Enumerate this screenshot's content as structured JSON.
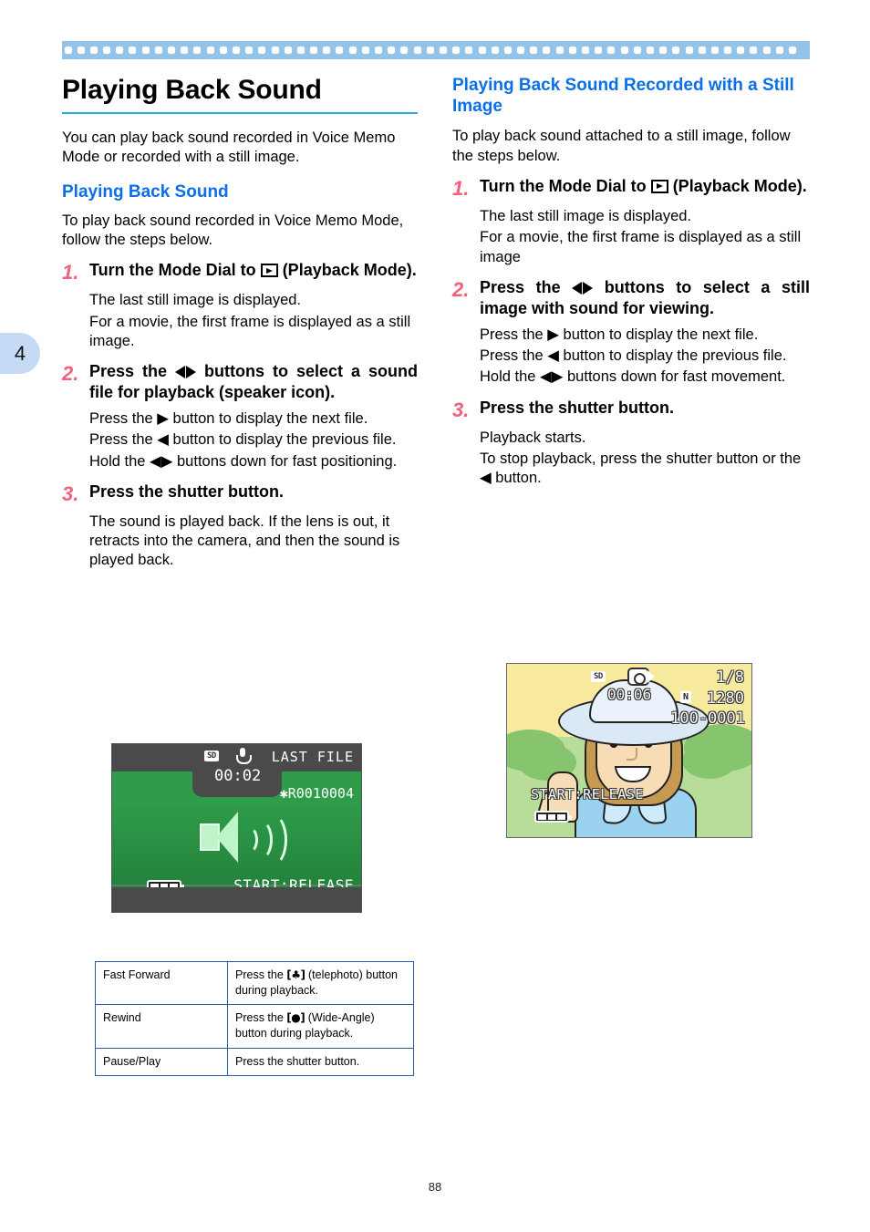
{
  "chapter": {
    "number": "4"
  },
  "page": {
    "number": "88"
  },
  "left": {
    "title": "Playing Back Sound",
    "intro": "You can play back sound recorded in Voice Memo Mode or recorded with a still image.",
    "subheading": "Playing Back Sound",
    "lead": "To play back sound recorded in Voice Memo Mode, follow the steps below.",
    "steps": [
      {
        "num": "1.",
        "head_before": "Turn the Mode Dial to",
        "head_after": "(Playback Mode).",
        "body": [
          "The last still image is displayed.",
          "For a movie, the first frame is displayed as a still image."
        ]
      },
      {
        "num": "2.",
        "head_before": "Press the",
        "head_after": "buttons to select a sound file for playback (speaker icon).",
        "body": [
          "Press the ▶ button to display the next file.",
          "Press the ◀ button to display the previous file.",
          "Hold the ◀▶ buttons down for fast positioning."
        ]
      },
      {
        "num": "3.",
        "head_before": "Press the shutter button.",
        "head_after": "",
        "body": [
          "The sound is played back. If the lens is out, it retracts into the camera, and then the sound is played back."
        ]
      }
    ],
    "lcd": {
      "sd_label": "SD",
      "timer": "00:02",
      "last_file": "LAST FILE",
      "filename": "✱R0010004",
      "start": "START:RELEASE"
    },
    "table": {
      "rows": [
        {
          "action": "Fast Forward",
          "desc_before": "Press the",
          "icon": "telephoto-icon",
          "desc_after": "(telephoto) button during playback."
        },
        {
          "action": "Rewind",
          "desc_before": "Press the",
          "icon": "wide-angle-icon",
          "desc_after": "(Wide-Angle) button during playback."
        },
        {
          "action": "Pause/Play",
          "desc_before": "Press the shutter button.",
          "icon": "",
          "desc_after": ""
        }
      ]
    }
  },
  "right": {
    "subheading": "Playing Back Sound Recorded with a Still Image",
    "lead": "To play back sound attached to a still image, follow the steps below.",
    "steps": [
      {
        "num": "1.",
        "head_before": "Turn the Mode Dial to",
        "head_after": "(Playback Mode).",
        "body": [
          "The last still image is displayed.",
          "For a movie, the first frame is displayed as a still image"
        ]
      },
      {
        "num": "2.",
        "head_before": "Press the",
        "head_after": "buttons to select a still image with sound for viewing.",
        "body": [
          "Press the ▶ button to display the next file.",
          "Press the ◀ button to display the previous file.",
          "Hold the ◀▶ buttons down for fast movement."
        ]
      },
      {
        "num": "3.",
        "head_before": "Press the shutter button.",
        "head_after": "",
        "body": [
          "Playback starts.",
          "To stop playback, press the shutter button or the ◀ button."
        ]
      }
    ],
    "lcd": {
      "sd_label": "SD",
      "timer": "00:06",
      "fraction": "1/8",
      "n_mark": "N",
      "image_size": "1280",
      "file_number": "100-0001",
      "start": "START:RELEASE"
    }
  },
  "colors": {
    "heading_blue": "#0b6fe8",
    "rule_cyan": "#29abe2",
    "step_pink": "#f4607f",
    "band_blue": "#93c3e8",
    "tab_blue": "#c5daf5",
    "table_border": "#2a5fa8"
  }
}
